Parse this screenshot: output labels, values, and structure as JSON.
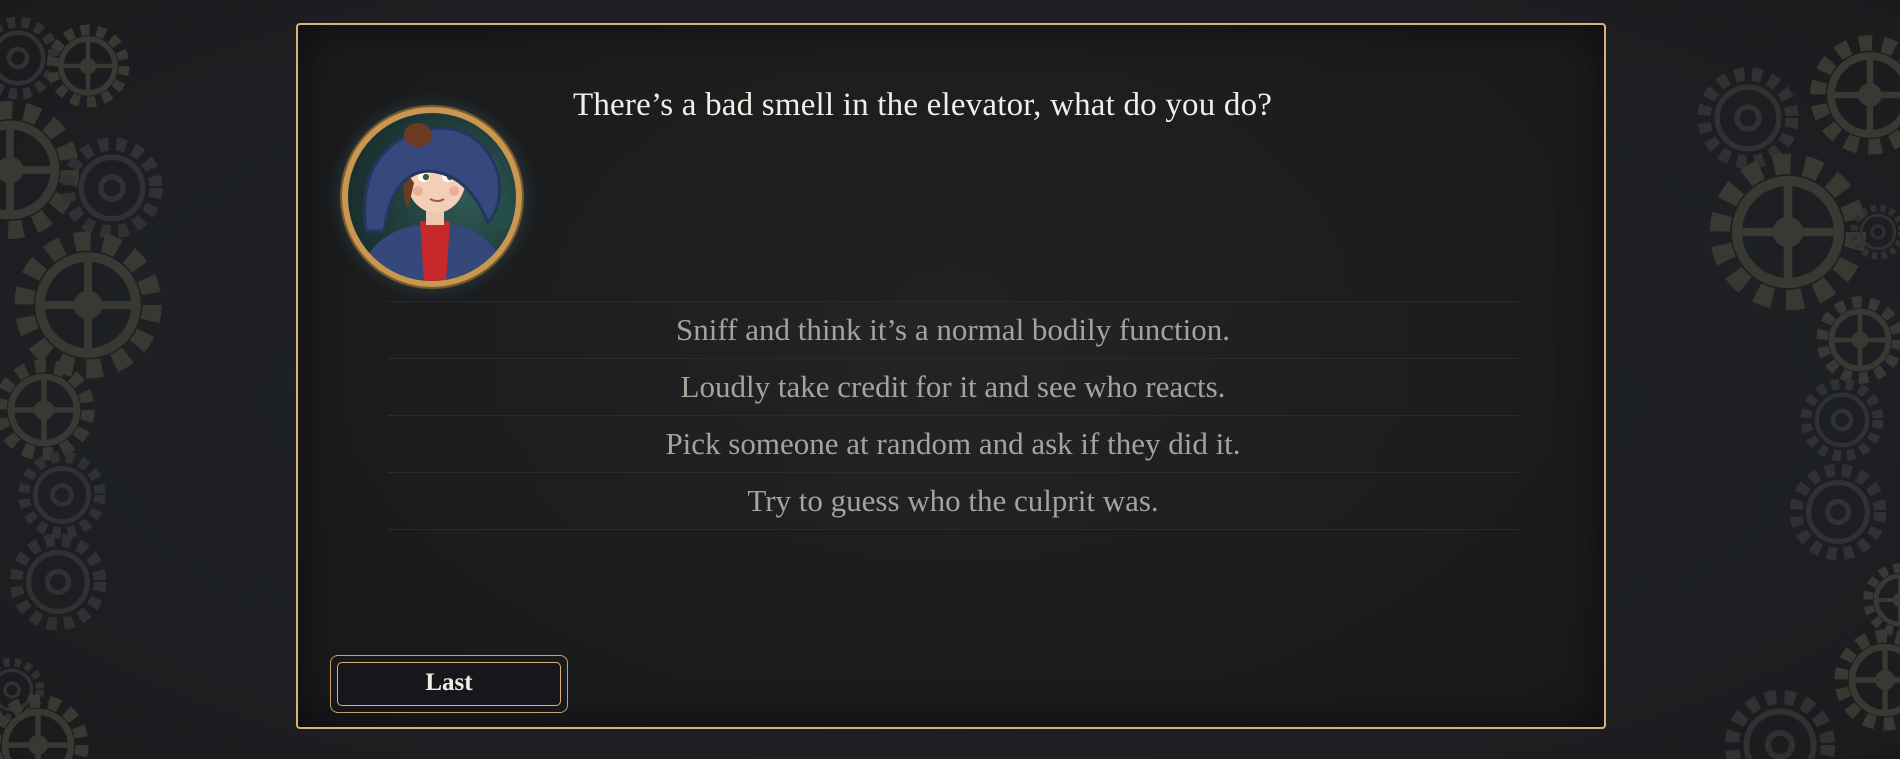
{
  "question": {
    "text": "There’s a bad smell in the elevator, what do you do?"
  },
  "portrait": {
    "icon": "character-portrait-girl-blue-bonnet"
  },
  "choices": [
    "Sniff and think it’s a normal bodily function.",
    "Loudly take credit for it and see who reacts.",
    "Pick someone at random and ask if they did it.",
    "Try to guess who the culprit was."
  ],
  "navigation": {
    "last_label": "Last"
  },
  "colors": {
    "accent_gold": "#d9b27a",
    "background": "#1f2124",
    "panel": "#1b1c1e",
    "choice_text": "#a7a39c",
    "question_text": "#f3eee6",
    "gear_tone": "#3a3832"
  }
}
